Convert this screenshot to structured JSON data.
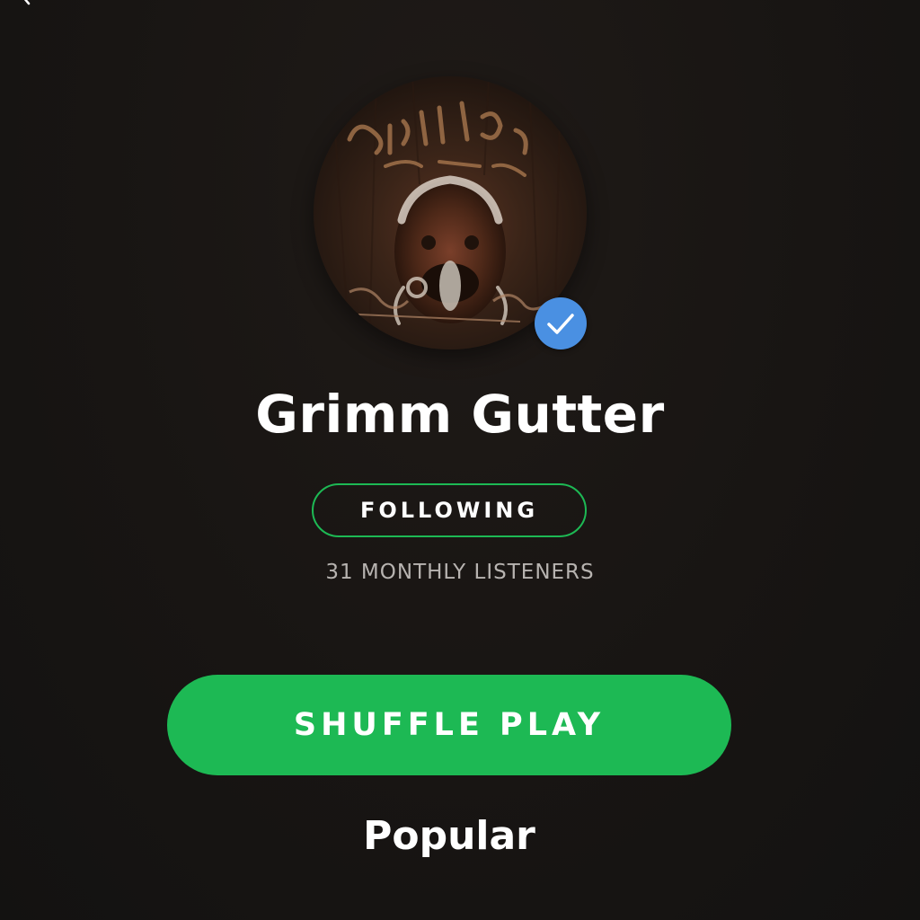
{
  "header": {
    "back_icon": "chevron-left-icon"
  },
  "artist": {
    "name": "Grimm Gutter",
    "avatar_icon": "artist-avatar",
    "verified_icon": "verified-check-icon"
  },
  "actions": {
    "follow_label": "FOLLOWING",
    "shuffle_label": "SHUFFLE PLAY"
  },
  "stats": {
    "monthly_listeners": "31 MONTHLY LISTENERS"
  },
  "sections": {
    "popular_title": "Popular"
  },
  "colors": {
    "accent_green": "#1db954",
    "verified_blue": "#4a90e2",
    "background": "#181513",
    "secondary_text": "#b7b3b0"
  }
}
